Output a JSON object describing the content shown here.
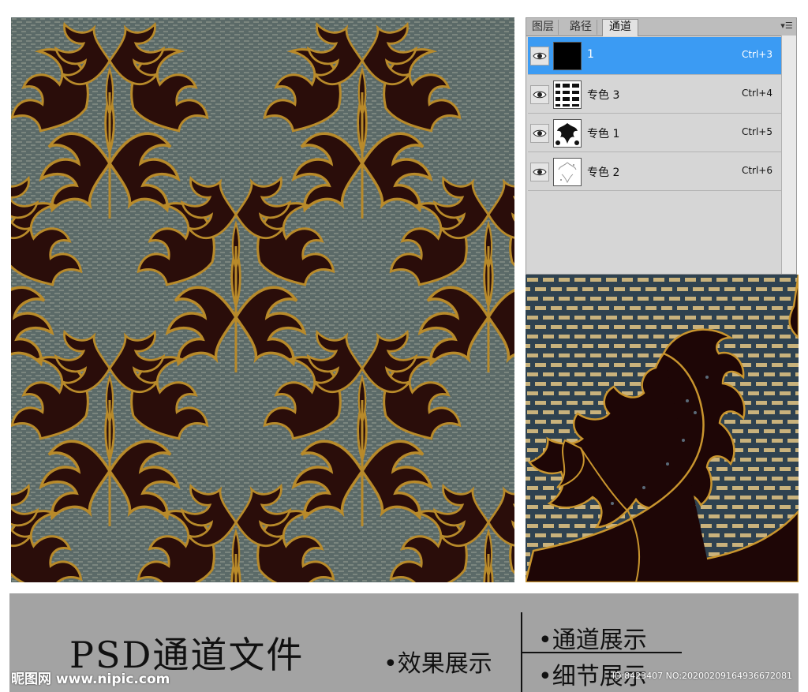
{
  "panel": {
    "tabs": [
      {
        "label": "图层",
        "active": false
      },
      {
        "label": "路径",
        "active": false
      },
      {
        "label": "通道",
        "active": true
      }
    ],
    "menu_icon": "panel-menu-icon",
    "channels": [
      {
        "name": "1",
        "shortcut": "Ctrl+3",
        "selected": true,
        "visible": true
      },
      {
        "name": "专色 3",
        "shortcut": "Ctrl+4",
        "selected": false,
        "visible": true
      },
      {
        "name": "专色 1",
        "shortcut": "Ctrl+5",
        "selected": false,
        "visible": true
      },
      {
        "name": "专色 2",
        "shortcut": "Ctrl+6",
        "selected": false,
        "visible": true
      }
    ]
  },
  "banner": {
    "title": "PSD通道文件",
    "bullet_effect": "•效果展示",
    "bullet_channel": "•通道展示",
    "bullet_detail": "•细节展示",
    "logo": "昵图网 www.nipic.com",
    "id_text": "ID:8423407 NO:20200209164936672081"
  },
  "colors": {
    "selected_row": "#3b9bf3",
    "pattern_bg": "#5b6a68",
    "leaf_dark": "#2a0d0a",
    "leaf_gold": "#b88a2a",
    "detail_bg": "#2f4250",
    "detail_dash": "#c9b27c",
    "banner_bg": "#a3a3a3"
  }
}
